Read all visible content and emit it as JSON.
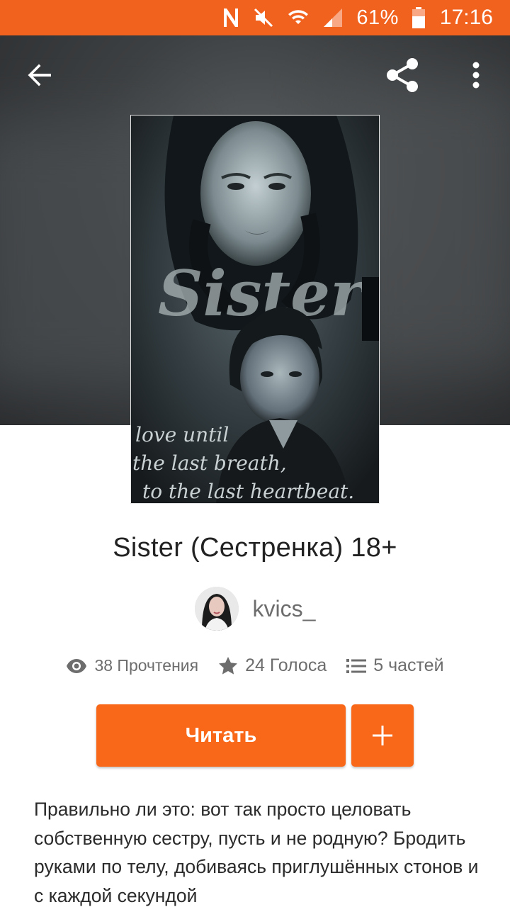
{
  "status_bar": {
    "battery_percent": "61%",
    "time": "17:16",
    "icons": [
      "nfc-icon",
      "mute-icon",
      "wifi-icon",
      "signal-icon",
      "battery-icon"
    ]
  },
  "toolbar": {
    "back_icon": "arrow-left-icon",
    "share_icon": "share-icon",
    "more_icon": "more-vertical-icon"
  },
  "story": {
    "cover_text": {
      "title_art": "Sister",
      "tagline_line1": "love until",
      "tagline_line2": "the last breath,",
      "tagline_line3": "to the last heartbeat."
    },
    "title": "Sister (Сестренка) 18+",
    "author": "kvics_",
    "stats": {
      "reads": "38 Прочтения",
      "votes": "24 Голоса",
      "parts": "5 частей"
    },
    "read_label": "Читать",
    "add_label": "+",
    "description": "Правильно ли это: вот так просто целовать собственную сестру, пусть и не родную? Бродить руками по телу, добиваясь приглушённых стонов и с каждой секундой"
  },
  "colors": {
    "accent": "#f96718",
    "status_bar": "#f2621f",
    "muted_text": "#6d6d6d"
  }
}
